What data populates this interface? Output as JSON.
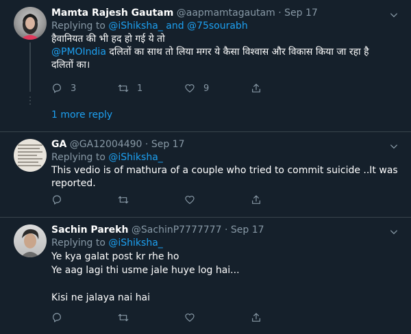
{
  "tweets": [
    {
      "name": "Mamta Rajesh Gautam",
      "handle": "@aapmamtagautam",
      "dot": "·",
      "date": "Sep 17",
      "reply_prefix": "Replying to",
      "reply_mentions": [
        "@iShiksha_",
        "and",
        "@75sourabh"
      ],
      "lines": [
        "हैवानियत की भी हद हो गई ये तो",
        "@PMOIndia",
        " दलितों का साथ तो लिया मगर ये कैसा विश्वास और विकास किया जा रहा है",
        "दलितों का।"
      ],
      "reply_count": "3",
      "retweet_count": "1",
      "like_count": "9",
      "more_reply": "1 more reply"
    },
    {
      "name": "GA",
      "handle": "@GA12004490",
      "dot": "·",
      "date": "Sep 17",
      "reply_prefix": "Replying to",
      "reply_mentions": [
        "@iShiksha_"
      ],
      "lines": [
        "This vedio is of mathura of a couple who tried to commit suicide ..It was",
        "reported."
      ],
      "reply_count": "",
      "retweet_count": "",
      "like_count": ""
    },
    {
      "name": "Sachin Parekh",
      "handle": "@SachinP7777777",
      "dot": "·",
      "date": "Sep 17",
      "reply_prefix": "Replying to",
      "reply_mentions": [
        "@iShiksha_"
      ],
      "lines": [
        "Ye kya galat post kr rhe ho",
        "Ye aag lagi thi usme jale huye log hai...",
        "",
        "Kisi ne jalaya nai hai"
      ],
      "reply_count": "",
      "retweet_count": "",
      "like_count": ""
    }
  ],
  "icons": {
    "reply": "reply-icon",
    "retweet": "retweet-icon",
    "like": "heart-icon",
    "share": "share-icon",
    "caret": "chevron-down-icon"
  },
  "colors": {
    "background": "#15202b",
    "border": "#38444d",
    "muted": "#8899a6",
    "link": "#1da1f2",
    "text": "#ffffff"
  }
}
